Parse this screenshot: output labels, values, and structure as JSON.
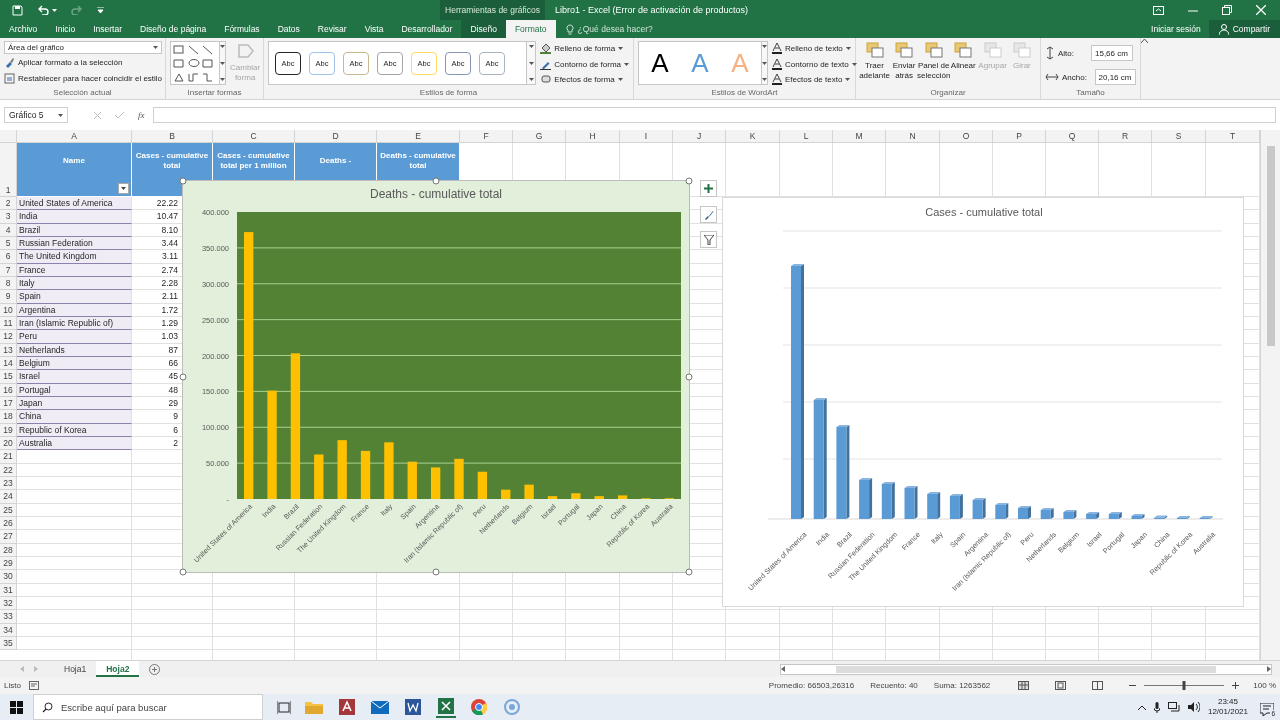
{
  "title_bar": {
    "context_label": "Herramientas de gráficos",
    "title": "Libro1 - Excel (Error de activación de productos)"
  },
  "tabs": [
    {
      "label": "Archivo",
      "selected": false,
      "contextual": false
    },
    {
      "label": "Inicio",
      "selected": false,
      "contextual": false
    },
    {
      "label": "Insertar",
      "selected": false,
      "contextual": false
    },
    {
      "label": "Diseño de página",
      "selected": false,
      "contextual": false
    },
    {
      "label": "Fórmulas",
      "selected": false,
      "contextual": false
    },
    {
      "label": "Datos",
      "selected": false,
      "contextual": false
    },
    {
      "label": "Revisar",
      "selected": false,
      "contextual": false
    },
    {
      "label": "Vista",
      "selected": false,
      "contextual": false
    },
    {
      "label": "Desarrollador",
      "selected": false,
      "contextual": false
    },
    {
      "label": "Diseño",
      "selected": false,
      "contextual": true
    },
    {
      "label": "Formato",
      "selected": true,
      "contextual": true
    }
  ],
  "tell_me": {
    "placeholder": "¿Qué desea hacer?"
  },
  "account": {
    "sign_in": "Iniciar sesión",
    "share": "Compartir"
  },
  "ribbon": {
    "groups": [
      {
        "kind": "selection",
        "label": "Selección actual",
        "dropdown": "Área del gráfico",
        "buttons": [
          "Aplicar formato a la selección",
          "Restablecer para hacer coincidir el estilo"
        ]
      },
      {
        "kind": "shapes",
        "label": "Insertar formas",
        "change_shape": {
          "label": "Cambiar forma",
          "disabled": true
        }
      },
      {
        "kind": "shape_styles",
        "label": "Estilos de forma",
        "swatches": [
          {
            "text": "Abc",
            "color": "#262626"
          },
          {
            "text": "Abc",
            "color": "#9dc3e6"
          },
          {
            "text": "Abc",
            "color": "#c9b78f"
          },
          {
            "text": "Abc",
            "color": "#a5a5a5"
          },
          {
            "text": "Abc",
            "color": "#ffd966"
          },
          {
            "text": "Abc",
            "color": "#8497b0"
          },
          {
            "text": "Abc",
            "color": "#a9b4c2"
          }
        ],
        "buttons": [
          "Relleno de forma",
          "Contorno de forma",
          "Efectos de forma"
        ]
      },
      {
        "kind": "wordart",
        "label": "Estilos de WordArt",
        "letters": [
          {
            "text": "A",
            "color": "#000000"
          },
          {
            "text": "A",
            "color": "#5b9bd5"
          },
          {
            "text": "A",
            "color": "#f4b183"
          }
        ],
        "buttons": [
          "Relleno de texto",
          "Contorno de texto",
          "Efectos de texto"
        ]
      },
      {
        "kind": "arrange",
        "label": "Organizar",
        "buttons": [
          {
            "label": "Traer adelante",
            "disabled": false
          },
          {
            "label": "Enviar atrás",
            "disabled": false
          },
          {
            "label": "Panel de selección",
            "disabled": false
          },
          {
            "label": "Alinear",
            "disabled": false
          },
          {
            "label": "Agrupar",
            "disabled": true
          },
          {
            "label": "Girar",
            "disabled": true
          }
        ]
      },
      {
        "kind": "size",
        "label": "Tamaño",
        "fields": [
          {
            "label": "Alto:",
            "value": "15,66 cm"
          },
          {
            "label": "Ancho:",
            "value": "20,16 cm"
          }
        ]
      }
    ]
  },
  "formula_bar": {
    "name_box": "Gráfico 5",
    "function_label": "fx"
  },
  "sheet": {
    "columns": [
      "A",
      "B",
      "C",
      "D",
      "E",
      "F",
      "G",
      "H",
      "I",
      "J",
      "K",
      "L",
      "M",
      "N",
      "O",
      "P",
      "Q",
      "R",
      "S",
      "T"
    ],
    "header_cells": [
      "Name",
      "Cases - cumulative total",
      "Cases - cumulative total per 1 million",
      "Deaths -",
      "Deaths - cumulative total"
    ],
    "row_numbers": [
      "1",
      "2",
      "3",
      "4",
      "5",
      "6",
      "7",
      "8",
      "9",
      "10",
      "11",
      "12",
      "13",
      "14",
      "15",
      "16",
      "17",
      "18",
      "19",
      "20",
      "21",
      "22",
      "23",
      "24",
      "25",
      "26",
      "27",
      "28",
      "29",
      "30",
      "31",
      "32",
      "33",
      "34",
      "35"
    ],
    "rows": [
      {
        "name": "United States of America",
        "cases": "22.22"
      },
      {
        "name": "India",
        "cases": "10.47"
      },
      {
        "name": "Brazil",
        "cases": "8.10"
      },
      {
        "name": "Russian Federation",
        "cases": "3.44"
      },
      {
        "name": "The United Kingdom",
        "cases": "3.11"
      },
      {
        "name": "France",
        "cases": "2.74"
      },
      {
        "name": "Italy",
        "cases": "2.28"
      },
      {
        "name": "Spain",
        "cases": "2.11"
      },
      {
        "name": "Argentina",
        "cases": "1.72"
      },
      {
        "name": "Iran (Islamic Republic of)",
        "cases": "1.29"
      },
      {
        "name": "Peru",
        "cases": "1.03"
      },
      {
        "name": "Netherlands",
        "cases": "87"
      },
      {
        "name": "Belgium",
        "cases": "66"
      },
      {
        "name": "Israel",
        "cases": "45"
      },
      {
        "name": "Portugal",
        "cases": "48"
      },
      {
        "name": "Japan",
        "cases": "29"
      },
      {
        "name": "China",
        "cases": "9"
      },
      {
        "name": "Republic of Korea",
        "cases": "6"
      },
      {
        "name": "Australia",
        "cases": "2"
      }
    ]
  },
  "deaths_chart": {
    "chart_data": {
      "type": "bar",
      "title": "Deaths - cumulative total",
      "categories": [
        "United States of America",
        "India",
        "Brazil",
        "Russian Federation",
        "The United Kingdom",
        "France",
        "Italy",
        "Spain",
        "Argentina",
        "Iran (Islamic Republic of)",
        "Peru",
        "Netherlands",
        "Belgium",
        "Israel",
        "Portugal",
        "Japan",
        "China",
        "Republic of Korea",
        "Australia"
      ],
      "series": [
        {
          "color": "#ffc000",
          "values": [
            372,
            151,
            203,
            62,
            82,
            67,
            79,
            52,
            44,
            56,
            38,
            13,
            20,
            4,
            8,
            4,
            5,
            1,
            1
          ]
        }
      ],
      "grid": true,
      "ylim": [
        0,
        400
      ],
      "yticks": [
        {
          "value": 0,
          "label": "-"
        },
        {
          "value": 50,
          "label": "50.000"
        },
        {
          "value": 100,
          "label": "100.000"
        },
        {
          "value": 150,
          "label": "150.000"
        },
        {
          "value": 200,
          "label": "200.000"
        },
        {
          "value": 250,
          "label": "250.000"
        },
        {
          "value": 300,
          "label": "300.000"
        },
        {
          "value": 350,
          "label": "350.000"
        },
        {
          "value": 400,
          "label": "400.000"
        }
      ]
    }
  },
  "cases_chart": {
    "title": "Cases - cumulative total",
    "categories": [
      "United States of America",
      "India",
      "Brazil",
      "Russian Federation",
      "The United Kingdom",
      "France",
      "Italy",
      "Spain",
      "Argentina",
      "Iran (Islamic Republic of)",
      "Peru",
      "Netherlands",
      "Belgium",
      "Israel",
      "Portugal",
      "Japan",
      "China",
      "Republic of Korea",
      "Australia"
    ]
  },
  "sheet_tabs": [
    {
      "label": "Hoja1",
      "selected": false
    },
    {
      "label": "Hoja2",
      "selected": true
    }
  ],
  "status_bar": {
    "ready": "Listo",
    "average": "Promedio: 66503,26316",
    "count": "Recuento: 40",
    "sum": "Suma: 1263562",
    "zoom": "100 %",
    "zoom_slider": {
      "level": 0.5
    }
  },
  "taskbar": {
    "search_placeholder": "Escribe aquí para buscar",
    "time": "23:45",
    "date": "12/01/2021",
    "notification_count": "6"
  }
}
